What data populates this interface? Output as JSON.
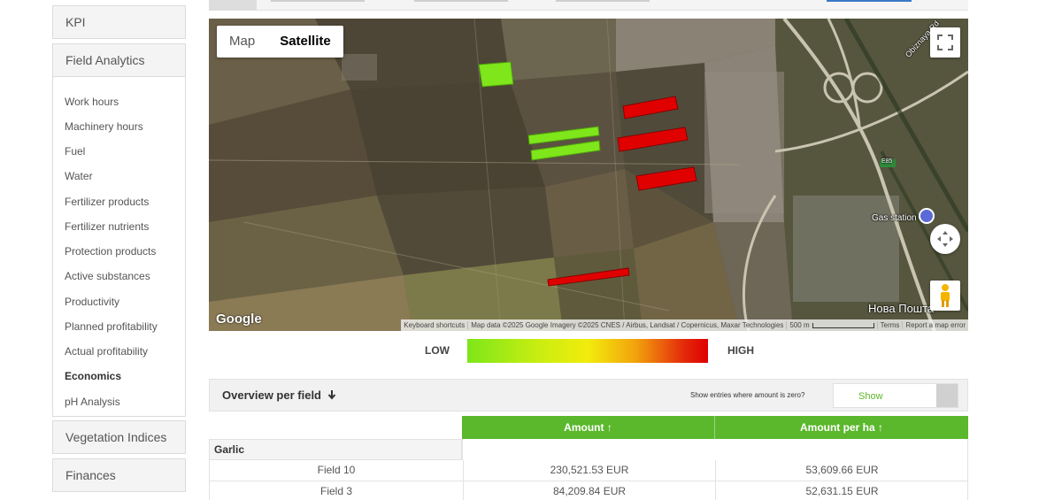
{
  "sidebar": {
    "sections": [
      "KPI",
      "Field Analytics",
      "Vegetation Indices",
      "Finances"
    ],
    "field_analytics_items": [
      "Work hours",
      "Machinery hours",
      "Fuel",
      "Water",
      "Fertilizer products",
      "Fertilizer nutrients",
      "Protection products",
      "Active substances",
      "Productivity",
      "Planned profitability",
      "Actual profitability",
      "Economics",
      "pH Analysis"
    ],
    "active_item": "Economics"
  },
  "map": {
    "type_map": "Map",
    "type_satellite": "Satellite",
    "selected_type": "Satellite",
    "google": "Google",
    "attribution": {
      "shortcuts": "Keyboard shortcuts",
      "data": "Map data ©2025 Google Imagery ©2025 CNES / Airbus, Landsat / Copernicus, Maxar Technologies",
      "scale": "500 m",
      "terms": "Terms",
      "report": "Report a map error"
    },
    "labels": {
      "road": "Obiznaya Rd",
      "highway": "E85",
      "gas": "Gas station",
      "poshta": "Нова Пошта"
    },
    "colors": {
      "green": "#7ee61a",
      "red": "#e00000"
    }
  },
  "legend": {
    "low": "LOW",
    "high": "HIGH"
  },
  "overview": {
    "title": "Overview per field",
    "sort_icon": "arrow-down",
    "zero_label": "Show entries where amount is zero?",
    "toggle_label": "Show"
  },
  "table": {
    "headers": [
      "Amount ↑",
      "Amount per ha ↑"
    ],
    "group": "Garlic",
    "rows": [
      {
        "field": "Field 10",
        "amount": "230,521.53 EUR",
        "per_ha": "53,609.66 EUR"
      },
      {
        "field": "Field 3",
        "amount": "84,209.84 EUR",
        "per_ha": "52,631.15 EUR"
      }
    ]
  },
  "accent_color": "#5bb72c"
}
